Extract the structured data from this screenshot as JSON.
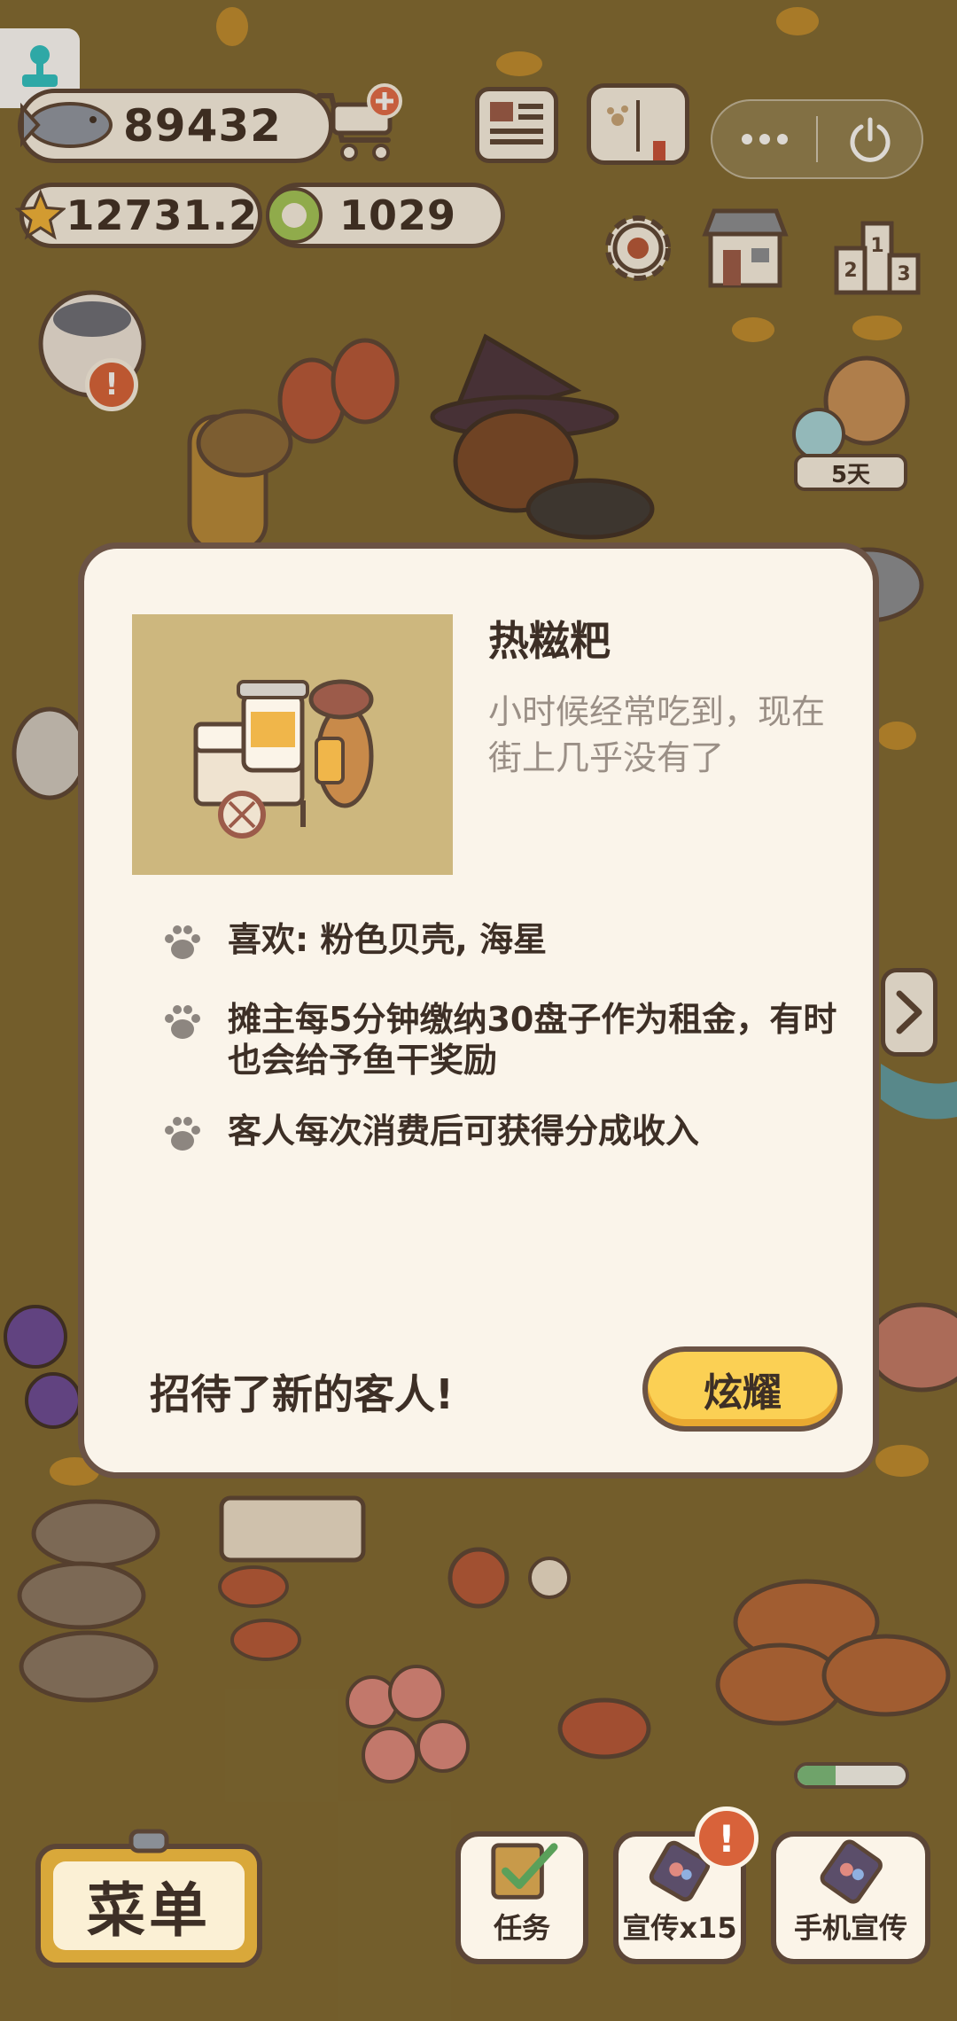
{
  "hud": {
    "fish_count": "89432",
    "star_count": "12731.2",
    "coin_count": "1029"
  },
  "event": {
    "days_left": "5天"
  },
  "modal": {
    "title": "热糍粑",
    "description": "小时候经常吃到，现在街上几乎没有了",
    "bullets": [
      "喜欢: 粉色贝壳, 海星",
      "摊主每5分钟缴纳30盘子作为租金，有时也会给予鱼干奖励",
      "客人每次消费后可获得分成收入"
    ],
    "footer": "招待了新的客人!",
    "action_label": "炫耀"
  },
  "bottom_bar": {
    "menu_label": "菜单",
    "tasks_label": "任务",
    "promote_label": "宣传x15",
    "phone_promote_label": "手机宣传",
    "badge_text": "!"
  },
  "progress": {
    "level": 0.35
  },
  "colors": {
    "background": "#7f6a33",
    "panel": "#faf4ea",
    "outline": "#6b5345",
    "accent_yellow": "#fbd054",
    "alert_red": "#d8623a",
    "thumbnail_bg": "#cdb77e"
  }
}
